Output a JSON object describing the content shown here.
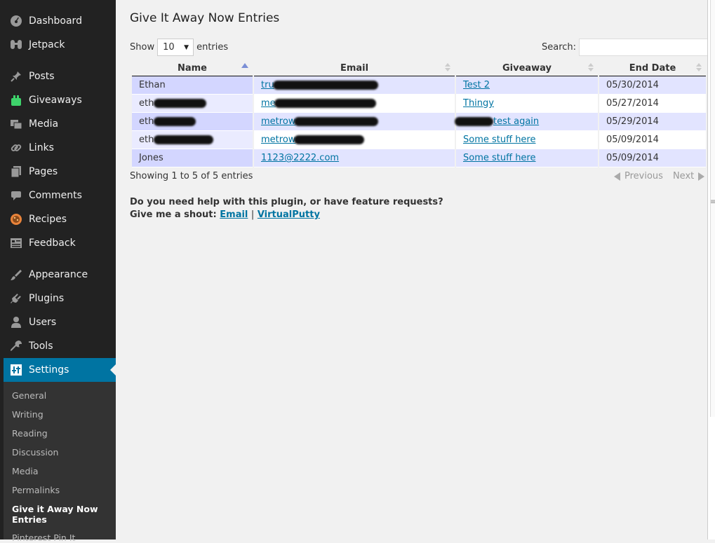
{
  "sidebar": {
    "items": [
      {
        "label": "Dashboard",
        "icon": "dashboard-icon"
      },
      {
        "label": "Jetpack",
        "icon": "jetpack-icon"
      },
      {
        "label": "Posts",
        "icon": "pin-icon"
      },
      {
        "label": "Giveaways",
        "icon": "giveaway-icon"
      },
      {
        "label": "Media",
        "icon": "media-icon"
      },
      {
        "label": "Links",
        "icon": "link-icon"
      },
      {
        "label": "Pages",
        "icon": "pages-icon"
      },
      {
        "label": "Comments",
        "icon": "comment-icon"
      },
      {
        "label": "Recipes",
        "icon": "recipe-icon"
      },
      {
        "label": "Feedback",
        "icon": "feedback-icon"
      },
      {
        "label": "Appearance",
        "icon": "brush-icon"
      },
      {
        "label": "Plugins",
        "icon": "plugin-icon"
      },
      {
        "label": "Users",
        "icon": "user-icon"
      },
      {
        "label": "Tools",
        "icon": "wrench-icon"
      },
      {
        "label": "Settings",
        "icon": "settings-icon"
      }
    ],
    "submenu": [
      "General",
      "Writing",
      "Reading",
      "Discussion",
      "Media",
      "Permalinks",
      "Give it Away Now Entries",
      "Pinterest Pin It"
    ]
  },
  "page": {
    "title": "Give It Away Now Entries",
    "show_label": "Show",
    "entries_label": "entries",
    "length_value": "10",
    "search_label": "Search:",
    "search_value": ""
  },
  "table": {
    "columns": [
      "Name",
      "Email",
      "Giveaway",
      "End Date"
    ],
    "rows": [
      {
        "name": "Ethan",
        "email": "tru",
        "giveaway": "Test 2",
        "end_date": "05/30/2014"
      },
      {
        "name": "eth",
        "email": "me",
        "giveaway": "Thingy",
        "end_date": "05/27/2014"
      },
      {
        "name": "eth",
        "email": "metrow",
        "giveaway": "test again",
        "end_date": "05/29/2014"
      },
      {
        "name": "eth",
        "email": "metrow",
        "giveaway": "Some stuff here",
        "end_date": "05/09/2014"
      },
      {
        "name": "Jones",
        "email": "1123@2222.com",
        "giveaway": "Some stuff here",
        "end_date": "05/09/2014"
      }
    ],
    "info": "Showing 1 to 5 of 5 entries",
    "previous": "Previous",
    "next": "Next"
  },
  "help": {
    "line1": "Do you need help with this plugin, or have feature requests?",
    "line2_prefix": "Give me a shout:",
    "email_link": "Email",
    "separator": "|",
    "site_link": "VirtualPutty"
  },
  "colors": {
    "sidebar": "#222222",
    "active": "#0074a2",
    "link": "#0074a2",
    "row_odd": "#e2e4ff"
  }
}
